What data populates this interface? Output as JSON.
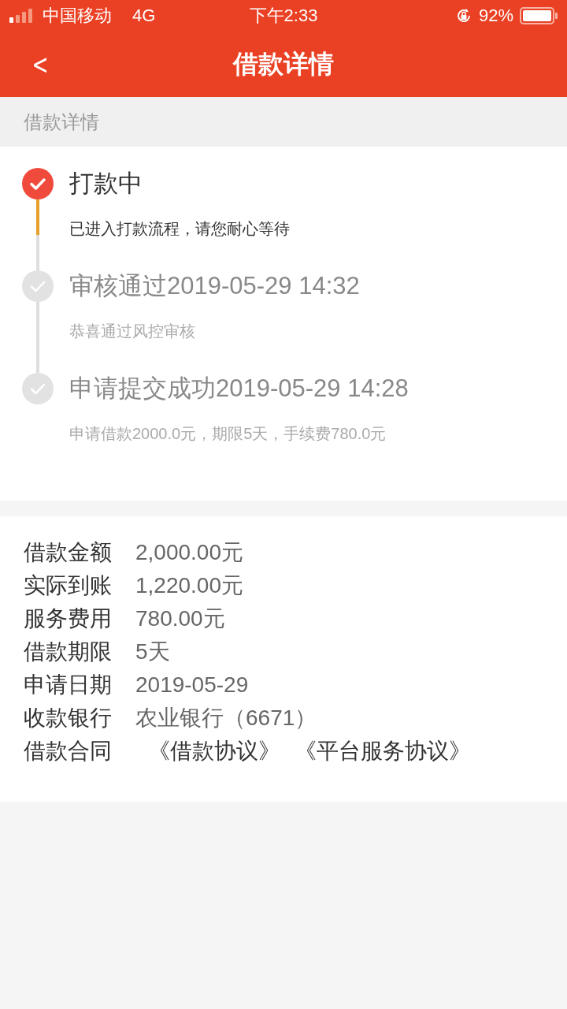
{
  "status_bar": {
    "carrier": "中国移动",
    "network": "4G",
    "time": "下午2:33",
    "battery": "92%"
  },
  "nav": {
    "back": "<",
    "title": "借款详情"
  },
  "section_label": "借款详情",
  "steps": [
    {
      "title": "打款中",
      "desc": "已进入打款流程，请您耐心等待",
      "active": true
    },
    {
      "title": "审核通过2019-05-29 14:32",
      "desc": "恭喜通过风控审核",
      "active": false
    },
    {
      "title": "申请提交成功2019-05-29 14:28",
      "desc": "申请借款2000.0元，期限5天，手续费780.0元",
      "active": false
    }
  ],
  "details": [
    {
      "kind": "text",
      "label": "借款金额",
      "value": "2,000.00元"
    },
    {
      "kind": "text",
      "label": "实际到账",
      "value": "1,220.00元"
    },
    {
      "kind": "text",
      "label": "服务费用",
      "value": "780.00元"
    },
    {
      "kind": "text",
      "label": "借款期限",
      "value": "5天"
    },
    {
      "kind": "text",
      "label": "申请日期",
      "value": "2019-05-29"
    },
    {
      "kind": "text",
      "label": "收款银行",
      "value": "农业银行（6671）"
    },
    {
      "kind": "links",
      "label": "借款合同",
      "links": [
        "《借款协议》",
        "《平台服务协议》"
      ]
    }
  ]
}
